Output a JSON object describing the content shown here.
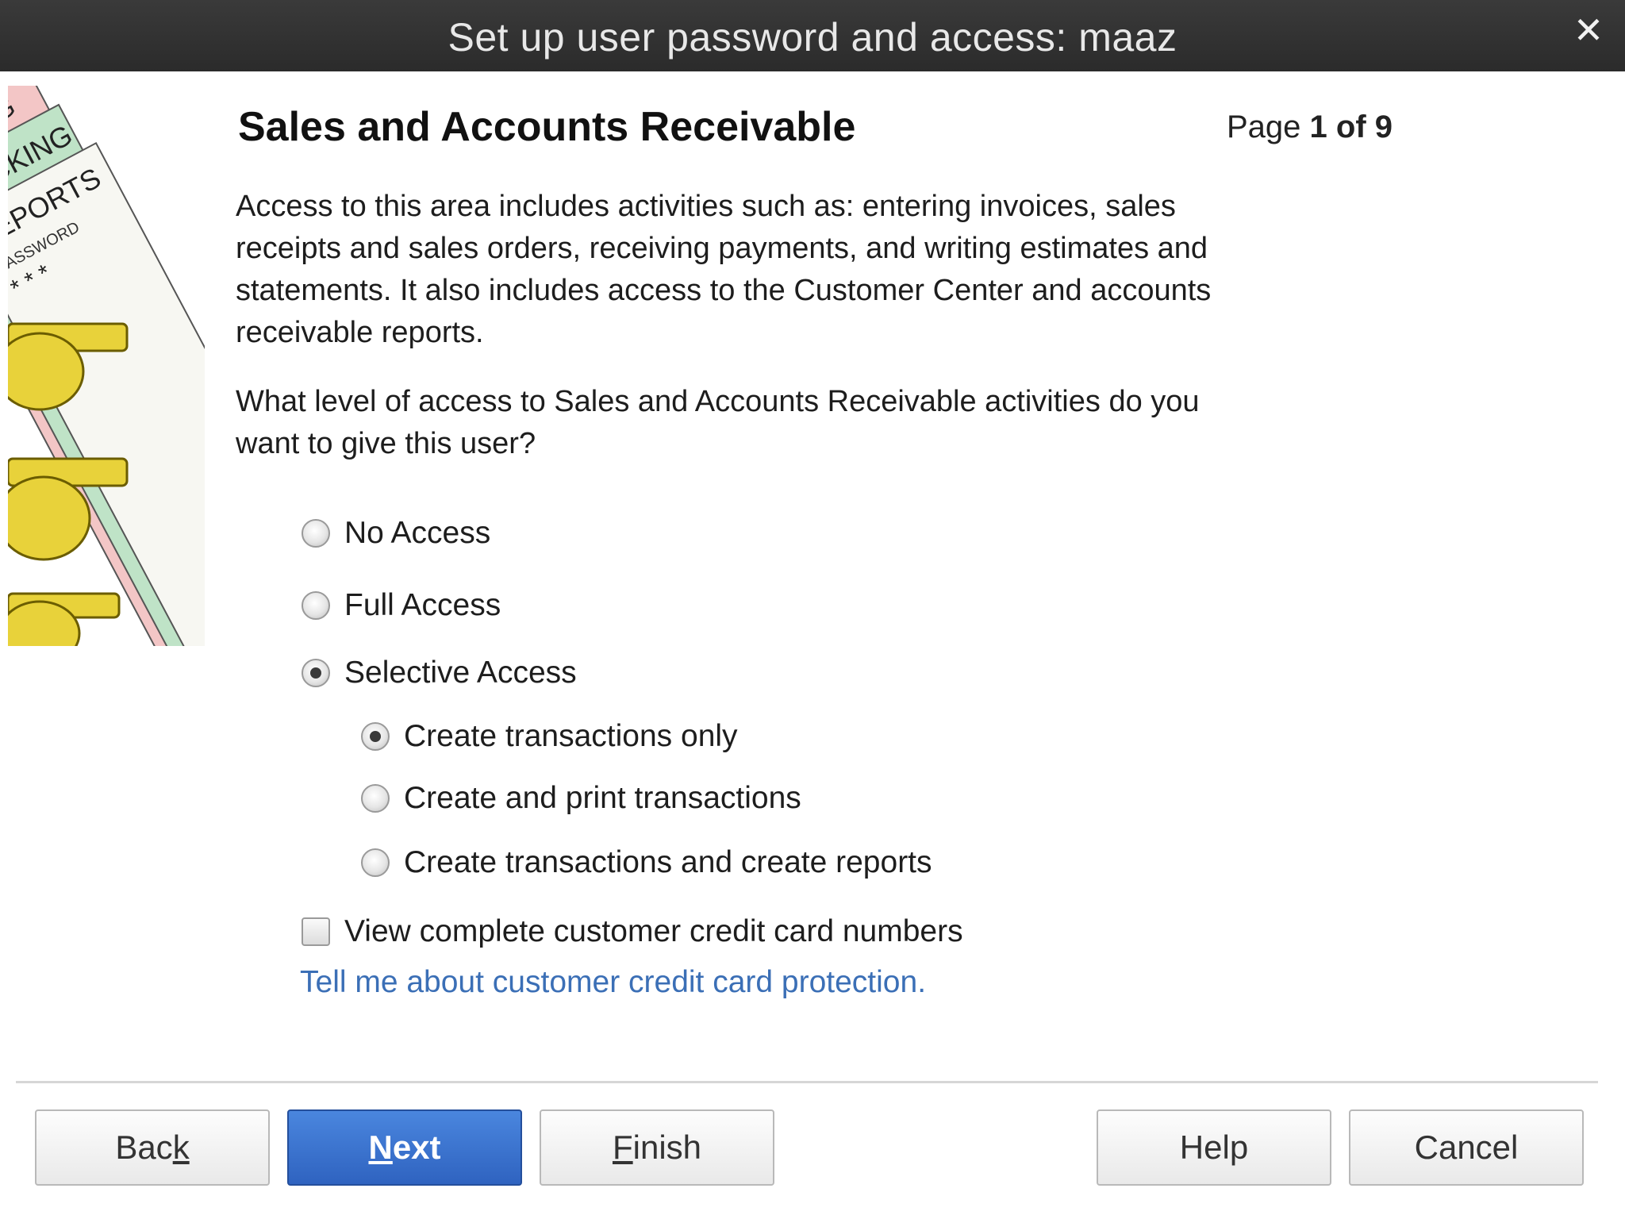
{
  "window": {
    "title": "Set up user password and access: maaz",
    "close_icon": "close-icon"
  },
  "illustration": {
    "tabs": [
      "BANKING",
      "TRACKING",
      "REPORTS",
      "PASSWORD"
    ],
    "password_mask": "* * *",
    "icon": "keys-illustration"
  },
  "page": {
    "heading": "Sales and Accounts Receivable",
    "indicator_prefix": "Page",
    "indicator_value": "1 of 9",
    "description": "Access to this area includes activities such as: entering invoices, sales receipts and sales orders, receiving payments, and writing estimates and statements. It also includes access to the Customer Center and accounts receivable reports.",
    "question": "What level of access to Sales and Accounts Receivable activities do you want to give this user?"
  },
  "access_options": [
    {
      "label": "No Access",
      "checked": false
    },
    {
      "label": "Full Access",
      "checked": false
    },
    {
      "label": "Selective Access",
      "checked": true
    }
  ],
  "selective_options": [
    {
      "label": "Create transactions only",
      "checked": true
    },
    {
      "label": "Create and print transactions",
      "checked": false
    },
    {
      "label": "Create transactions and create reports",
      "checked": false
    }
  ],
  "credit_card": {
    "checkbox_label": "View complete customer credit card numbers",
    "checked": false,
    "link_text": "Tell me about customer credit card protection."
  },
  "buttons": {
    "back": {
      "before": "Bac",
      "accel": "k",
      "after": ""
    },
    "next": {
      "before": "",
      "accel": "N",
      "after": "ext"
    },
    "finish": {
      "before": "",
      "accel": "F",
      "after": "inish"
    },
    "help": "Help",
    "cancel": "Cancel"
  },
  "colors": {
    "titlebar": "#2f2f2f",
    "primary_button": "#3a74d0",
    "link": "#3b6fb6"
  }
}
